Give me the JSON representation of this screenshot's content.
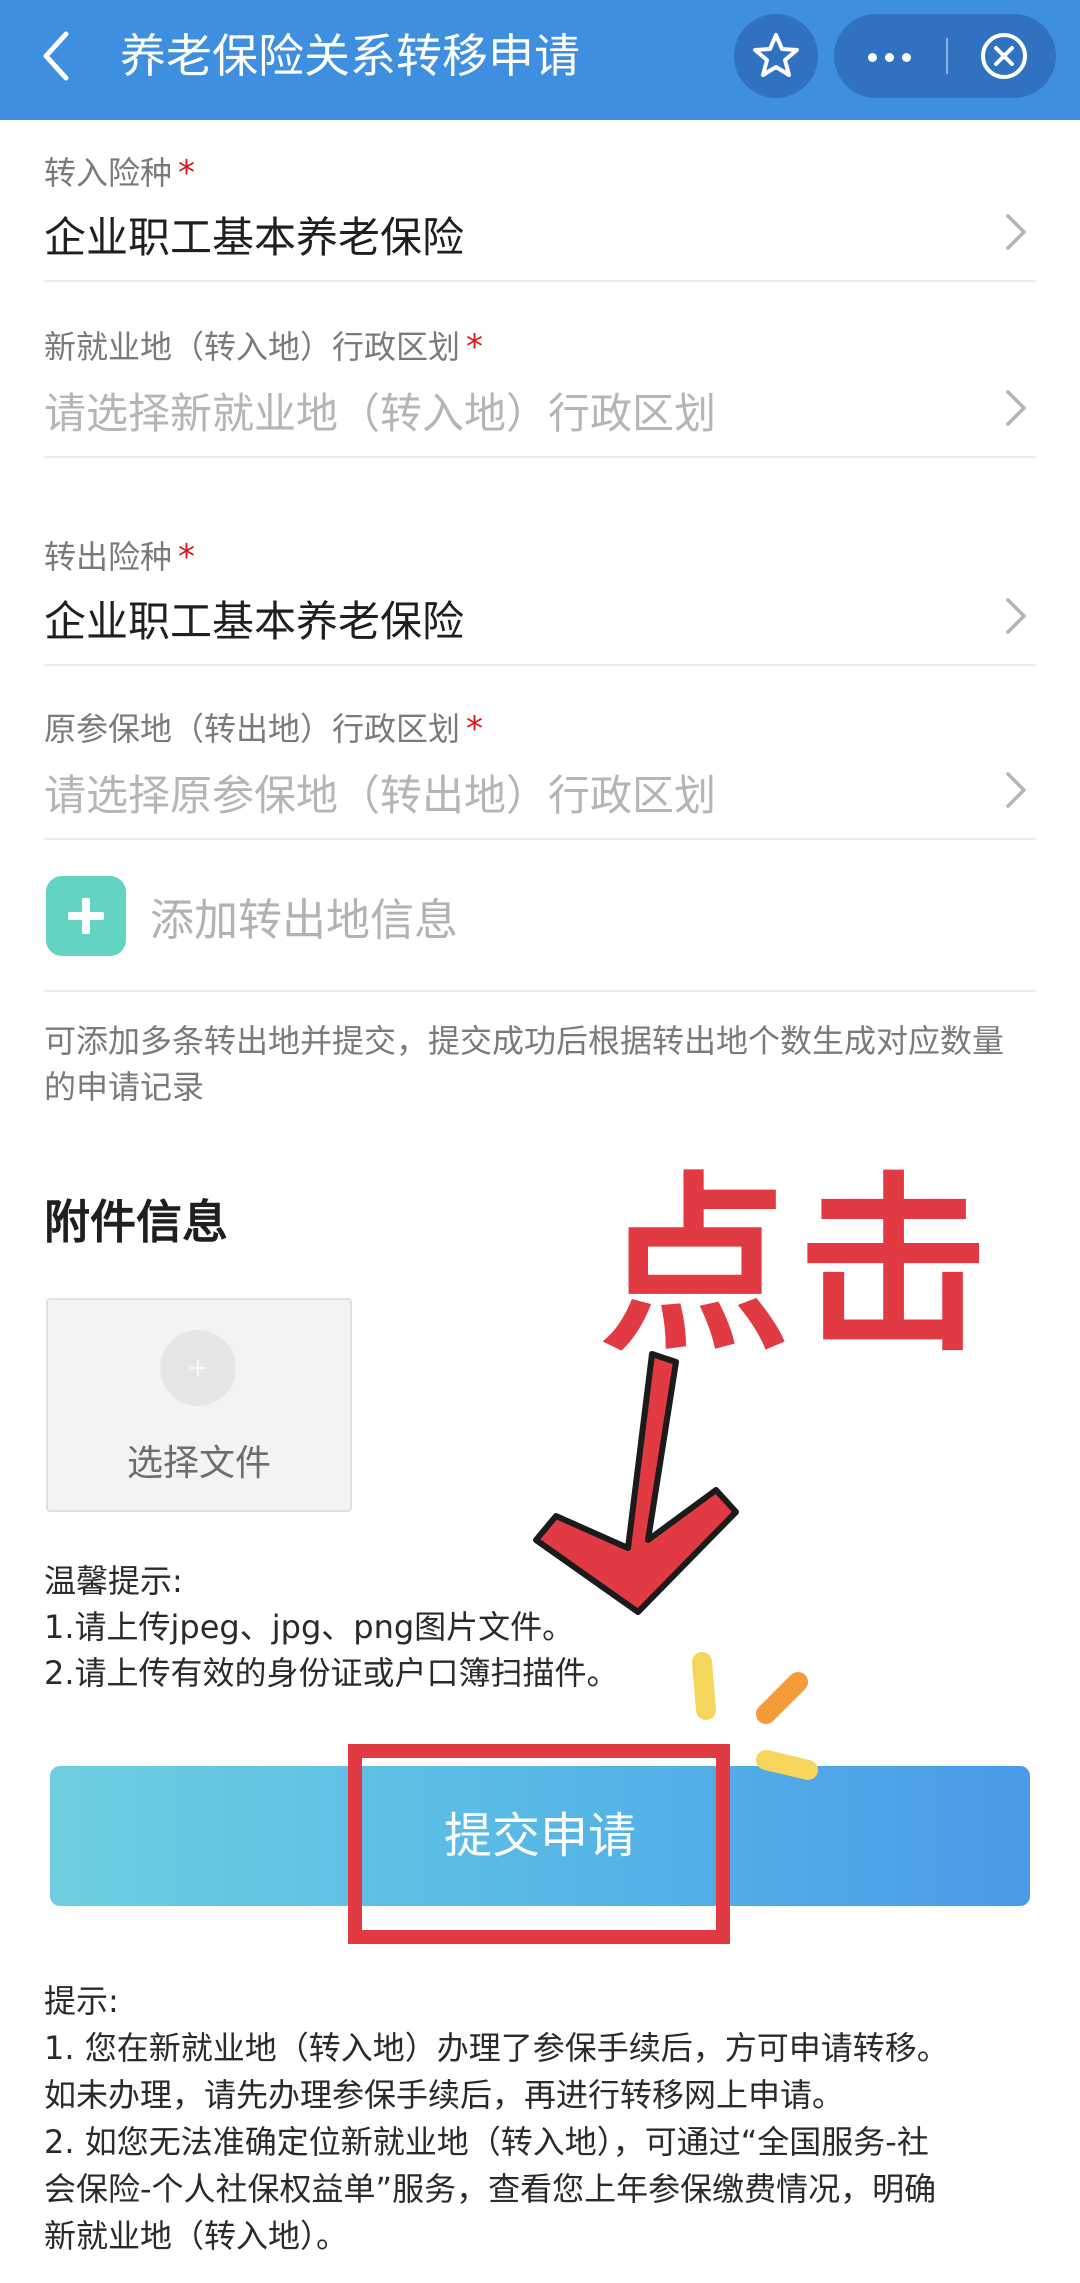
{
  "header": {
    "title": "养老保险关系转移申请",
    "back_icon": "chevron-left-icon",
    "star_icon": "star-icon",
    "more_icon": "more-dots-icon",
    "close_icon": "close-circle-icon",
    "background_color": "#3f8fe0"
  },
  "form": {
    "transfer_in_insurance": {
      "label": "转入险种",
      "required_mark": "*",
      "value": "企业职工基本养老保险"
    },
    "new_region": {
      "label": "新就业地（转入地）行政区划",
      "required_mark": "*",
      "placeholder": "请选择新就业地（转入地）行政区划"
    },
    "transfer_out_insurance": {
      "label": "转出险种",
      "required_mark": "*",
      "value": "企业职工基本养老保险"
    },
    "original_region": {
      "label": "原参保地（转出地）行政区划",
      "required_mark": "*",
      "placeholder": "请选择原参保地（转出地）行政区划"
    },
    "add_out_info_label": "添加转出地信息",
    "add_note": "可添加多条转出地并提交，提交成功后根据转出地个数生成对应数量的申请记录"
  },
  "attachments": {
    "title": "附件信息",
    "upload_label": "选择文件",
    "tips_title": "温馨提示:",
    "tips": [
      "1.请上传jpeg、jpg、png图片文件。",
      "2.请上传有效的身份证或户口簿扫描件。"
    ]
  },
  "submit_label": "提交申请",
  "hint": {
    "title": "提示:",
    "lines": [
      "1. 您在新就业地（转入地）办理了参保手续后，方可申请转移。",
      "如未办理，请先办理参保手续后，再进行转移网上申请。",
      "2. 如您无法准确定位新就业地（转入地），可通过“全国服务-社",
      "会保险-个人社保权益单”服务，查看您上年参保缴费情况，明确",
      "新就业地（转入地）。"
    ]
  },
  "annotation": {
    "text": "点击",
    "color": "#e23a43"
  },
  "colors": {
    "accent": "#3f8fe0",
    "required": "#d91a1a",
    "add_button": "#63d3c2"
  }
}
